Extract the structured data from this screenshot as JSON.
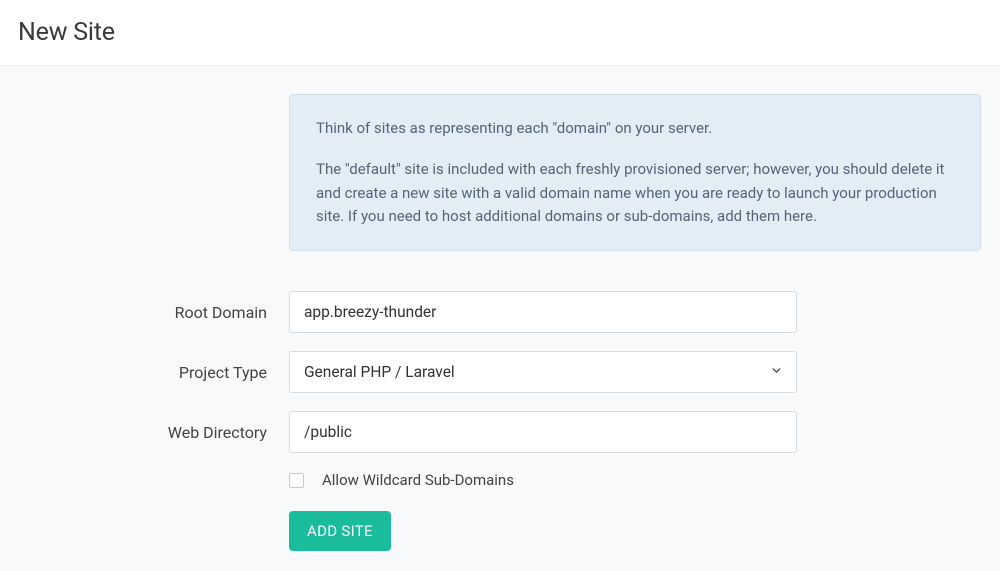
{
  "header": {
    "title": "New Site"
  },
  "infobox": {
    "p1": "Think of sites as representing each \"domain\" on your server.",
    "p2": "The \"default\" site is included with each freshly provisioned server; however, you should delete it and create a new site with a valid domain name when you are ready to launch your production site. If you need to host additional domains or sub-domains, add them here."
  },
  "form": {
    "root_domain": {
      "label": "Root Domain",
      "value": "app.breezy-thunder"
    },
    "project_type": {
      "label": "Project Type",
      "selected": "General PHP / Laravel"
    },
    "web_directory": {
      "label": "Web Directory",
      "value": "/public"
    },
    "wildcard": {
      "label": "Allow Wildcard Sub-Domains",
      "checked": false
    },
    "submit": {
      "label": "ADD SITE"
    }
  },
  "colors": {
    "primary": "#1abc9c",
    "info_bg": "#e2edf6"
  }
}
